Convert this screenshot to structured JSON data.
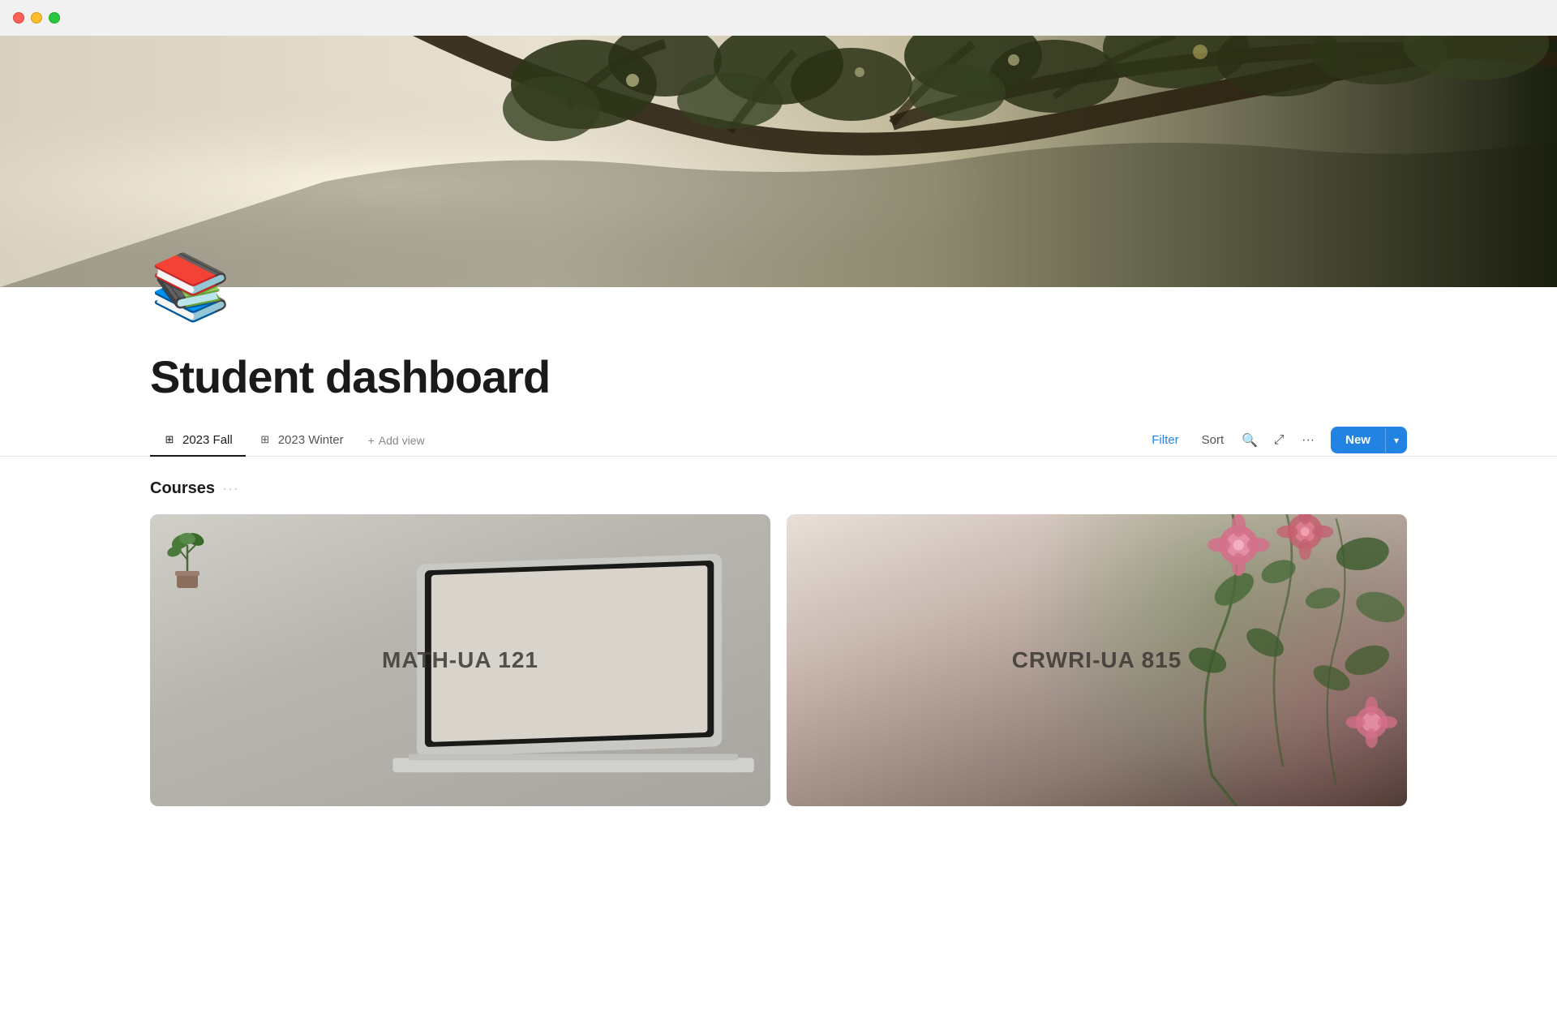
{
  "titlebar": {
    "traffic_close": "close",
    "traffic_minimize": "minimize",
    "traffic_maximize": "maximize"
  },
  "page": {
    "icon": "📚",
    "title": "Student dashboard"
  },
  "tabs": [
    {
      "id": "2023-fall",
      "label": "2023 Fall",
      "icon": "⊞",
      "active": true
    },
    {
      "id": "2023-winter",
      "label": "2023 Winter",
      "icon": "⊞",
      "active": false
    }
  ],
  "add_view": {
    "label": "Add view",
    "plus": "+"
  },
  "toolbar": {
    "filter_label": "Filter",
    "sort_label": "Sort",
    "search_label": "⌕",
    "expand_label": "⤢",
    "more_label": "···",
    "new_label": "New",
    "chevron_down": "⌄"
  },
  "courses_section": {
    "title": "Courses",
    "more_icon": "···"
  },
  "courses": [
    {
      "id": "math-ua-121",
      "code": "MATH-UA 121",
      "theme": "math"
    },
    {
      "id": "crwri-ua-815",
      "code": "CRWRI-UA 815",
      "theme": "crwri"
    }
  ]
}
